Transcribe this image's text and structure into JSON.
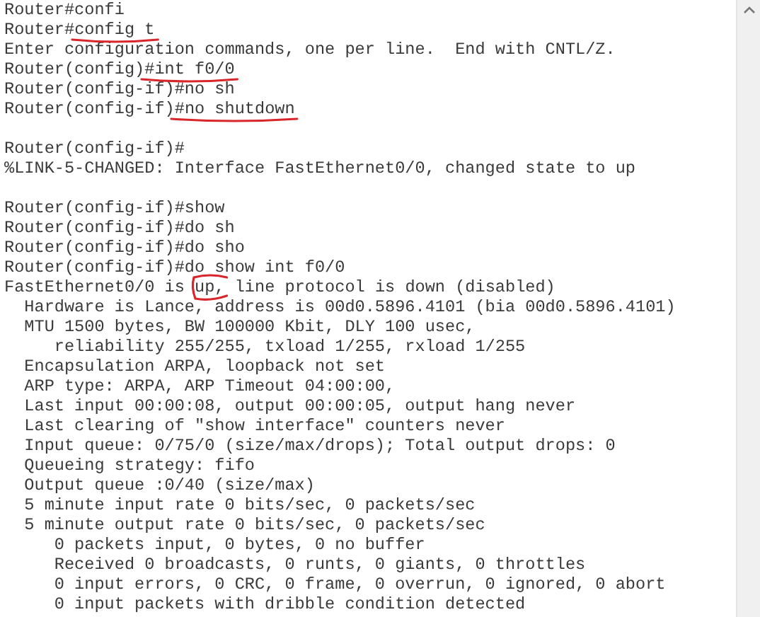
{
  "terminal": {
    "lines": [
      {
        "kind": "text",
        "segments": [
          {
            "text": "Router#confi"
          }
        ]
      },
      {
        "kind": "text",
        "segments": [
          {
            "text": "Router#"
          },
          {
            "text": "config t",
            "kind": "underlined"
          }
        ]
      },
      {
        "kind": "text",
        "segments": [
          {
            "text": "Enter configuration commands, one per line.  End with CNTL/Z."
          }
        ]
      },
      {
        "kind": "text",
        "segments": [
          {
            "text": "Router(config)"
          },
          {
            "text": "#int f0/0",
            "kind": "underlined"
          }
        ]
      },
      {
        "kind": "text",
        "segments": [
          {
            "text": "Router(config-if)#no sh"
          }
        ]
      },
      {
        "kind": "text",
        "segments": [
          {
            "text": "Router(config-if)"
          },
          {
            "text": "#no shutdown",
            "kind": "underlined"
          }
        ]
      },
      {
        "kind": "blank"
      },
      {
        "kind": "text",
        "segments": [
          {
            "text": "Router(config-if)#"
          }
        ]
      },
      {
        "kind": "text",
        "segments": [
          {
            "text": "%LINK-5-CHANGED: Interface FastEthernet0/0, changed state to up"
          }
        ]
      },
      {
        "kind": "blank"
      },
      {
        "kind": "text",
        "segments": [
          {
            "text": "Router(config-if)#show"
          }
        ]
      },
      {
        "kind": "text",
        "segments": [
          {
            "text": "Router(config-if)#do sh"
          }
        ]
      },
      {
        "kind": "text",
        "segments": [
          {
            "text": "Router(config-if)#do sho"
          }
        ]
      },
      {
        "kind": "text",
        "segments": [
          {
            "text": "Router(config-if)#do show int f0/0"
          }
        ]
      },
      {
        "kind": "text",
        "segments": [
          {
            "text": "FastEthernet0/0 is "
          },
          {
            "text": "up,",
            "kind": "circled"
          },
          {
            "text": " line protocol is down (disabled)"
          }
        ]
      },
      {
        "kind": "text",
        "segments": [
          {
            "text": "  Hardware is Lance, address is 00d0.5896.4101 (bia 00d0.5896.4101)"
          }
        ]
      },
      {
        "kind": "text",
        "segments": [
          {
            "text": "  MTU 1500 bytes, BW 100000 Kbit, DLY 100 usec,"
          }
        ]
      },
      {
        "kind": "text",
        "segments": [
          {
            "text": "     reliability 255/255, txload 1/255, rxload 1/255"
          }
        ]
      },
      {
        "kind": "text",
        "segments": [
          {
            "text": "  Encapsulation ARPA, loopback not set"
          }
        ]
      },
      {
        "kind": "text",
        "segments": [
          {
            "text": "  ARP type: ARPA, ARP Timeout 04:00:00,"
          }
        ]
      },
      {
        "kind": "text",
        "segments": [
          {
            "text": "  Last input 00:00:08, output 00:00:05, output hang never"
          }
        ]
      },
      {
        "kind": "text",
        "segments": [
          {
            "text": "  Last clearing of \"show interface\" counters never"
          }
        ]
      },
      {
        "kind": "text",
        "segments": [
          {
            "text": "  Input queue: 0/75/0 (size/max/drops); Total output drops: 0"
          }
        ]
      },
      {
        "kind": "text",
        "segments": [
          {
            "text": "  Queueing strategy: fifo"
          }
        ]
      },
      {
        "kind": "text",
        "segments": [
          {
            "text": "  Output queue :0/40 (size/max)"
          }
        ]
      },
      {
        "kind": "text",
        "segments": [
          {
            "text": "  5 minute input rate 0 bits/sec, 0 packets/sec"
          }
        ]
      },
      {
        "kind": "text",
        "segments": [
          {
            "text": "  5 minute output rate 0 bits/sec, 0 packets/sec"
          }
        ]
      },
      {
        "kind": "text",
        "segments": [
          {
            "text": "     0 packets input, 0 bytes, 0 no buffer"
          }
        ]
      },
      {
        "kind": "text",
        "segments": [
          {
            "text": "     Received 0 broadcasts, 0 runts, 0 giants, 0 throttles"
          }
        ]
      },
      {
        "kind": "text",
        "segments": [
          {
            "text": "     0 input errors, 0 CRC, 0 frame, 0 overrun, 0 ignored, 0 abort"
          }
        ]
      },
      {
        "kind": "text",
        "segments": [
          {
            "text": "     0 input packets with dribble condition detected"
          }
        ]
      }
    ]
  }
}
